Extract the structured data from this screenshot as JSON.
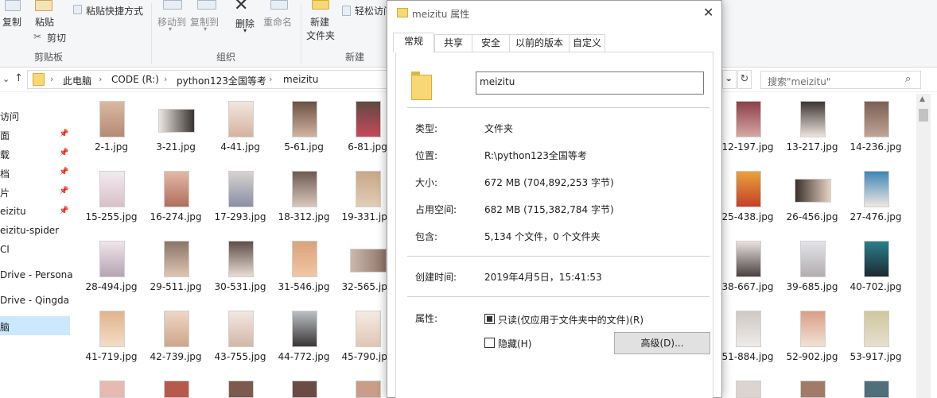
{
  "ribbon": {
    "copy": "复制",
    "paste": "粘贴",
    "paste_shortcut": "粘贴快捷方式",
    "cut": "剪切",
    "clipboard_group": "剪贴板",
    "move_to": "移动到",
    "copy_to": "复制到",
    "delete": "删除",
    "rename": "重命名",
    "organize_group": "组织",
    "new_folder_line1": "新建",
    "new_folder_line2": "文件夹",
    "easy_access": "轻松访问",
    "new_group": "新建"
  },
  "address": {
    "crumbs": [
      "此电脑",
      "CODE (R:)",
      "python123全国等考",
      "meizitu"
    ],
    "search_placeholder": "搜索\"meizitu\""
  },
  "nav": {
    "items": [
      "访问",
      "面",
      "载",
      "档",
      "片",
      "eizitu",
      "eizitu-spider",
      "Cl",
      "Drive - Persona",
      "Drive - Qingda",
      "脑"
    ]
  },
  "files": {
    "left": [
      [
        "2-1.jpg",
        "3-21.jpg",
        "4-41.jpg",
        "5-61.jpg",
        "6-81.jpg"
      ],
      [
        "15-255.jpg",
        "16-274.jpg",
        "17-293.jpg",
        "18-312.jpg",
        "19-331.jpg"
      ],
      [
        "28-494.jpg",
        "29-511.jpg",
        "30-531.jpg",
        "31-546.jpg",
        "32-565.jpg"
      ],
      [
        "41-719.jpg",
        "42-739.jpg",
        "43-755.jpg",
        "44-772.jpg",
        "45-790.jpg"
      ]
    ],
    "right": [
      [
        "12-197.jpg",
        "13-217.jpg",
        "14-236.jpg"
      ],
      [
        "25-438.jpg",
        "26-456.jpg",
        "27-476.jpg"
      ],
      [
        "38-667.jpg",
        "39-685.jpg",
        "40-702.jpg"
      ],
      [
        "51-884.jpg",
        "52-902.jpg",
        "53-917.jpg"
      ]
    ]
  },
  "dialog": {
    "title": "meizitu 属性",
    "tabs": [
      "常规",
      "共享",
      "安全",
      "以前的版本",
      "自定义"
    ],
    "name_value": "meizitu",
    "type_label": "类型:",
    "type_value": "文件夹",
    "location_label": "位置:",
    "location_value": "R:\\python123全国等考",
    "size_label": "大小:",
    "size_value": "672 MB (704,892,253 字节)",
    "size_on_disk_label": "占用空间:",
    "size_on_disk_value": "682 MB (715,382,784 字节)",
    "contains_label": "包含:",
    "contains_value": "5,134 个文件，0 个文件夹",
    "created_label": "创建时间:",
    "created_value": "2019年4月5日，15:41:53",
    "attributes_label": "属性:",
    "readonly_label": "只读(仅应用于文件夹中的文件)(R)",
    "readonly_checked": true,
    "hidden_label": "隐藏(H)",
    "hidden_checked": false,
    "advanced_button": "高级(D)..."
  },
  "colors": {
    "accent": "#0078d7",
    "folder": "#f8d775",
    "selection": "#cce8ff"
  }
}
